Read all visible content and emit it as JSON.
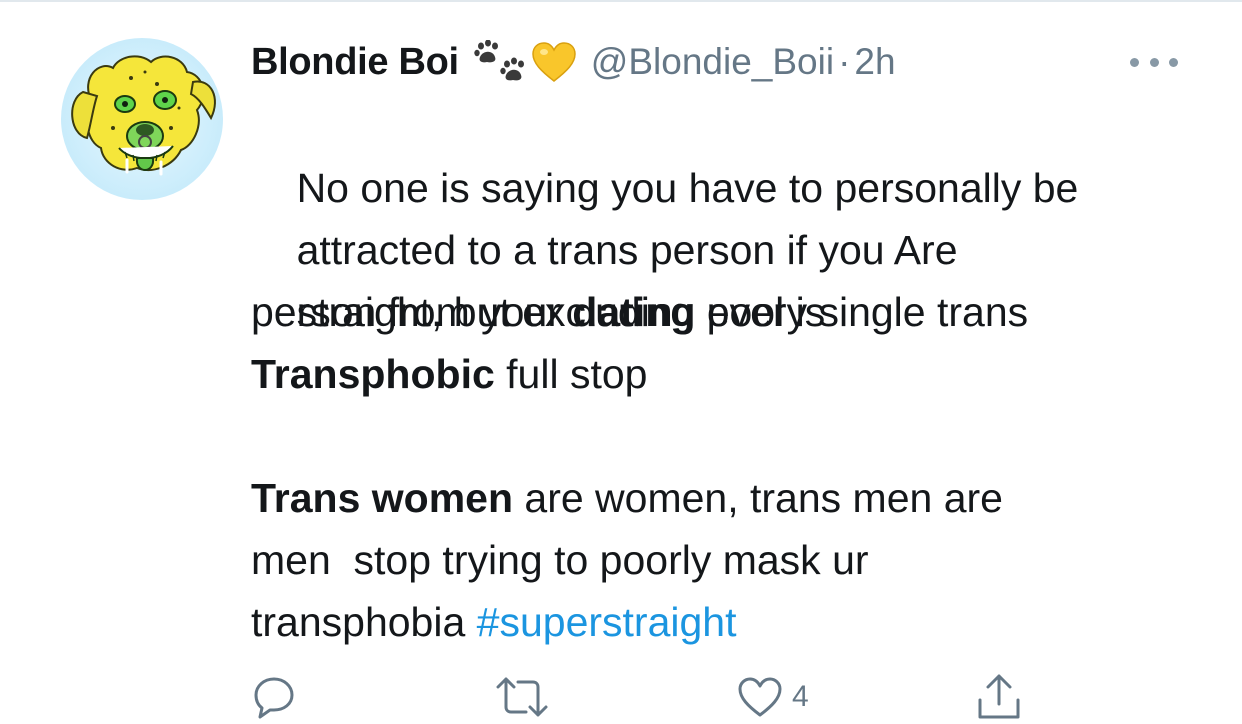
{
  "tweet": {
    "author": {
      "display_name": "Blondie Boi",
      "emoji": [
        "paw-prints",
        "yellow-heart"
      ],
      "handle": "@Blondie_Boii",
      "separator": "·",
      "time": "2h"
    },
    "body_lines": [
      [
        {
          "text": "No one is saying you have to personally be",
          "bold": false
        }
      ],
      [
        {
          "text": "attracted to a trans person if you Are",
          "bold": false
        }
      ],
      [
        {
          "text": "straight, but excluding every single trans",
          "bold": false
        }
      ],
      [
        {
          "text": "person from your ",
          "bold": false
        },
        {
          "text": "dating",
          "bold": true
        },
        {
          "text": " pool is",
          "bold": false
        }
      ],
      [
        {
          "text": "Transphobic",
          "bold": true
        },
        {
          "text": " full stop",
          "bold": false
        }
      ],
      [],
      [
        {
          "text": "Trans women",
          "bold": true
        },
        {
          "text": " are women, trans men are",
          "bold": false
        }
      ],
      [
        {
          "text": "men  stop trying to poorly mask ur",
          "bold": false
        }
      ],
      [
        {
          "text": "transphobia ",
          "bold": false
        },
        {
          "text": "#superstraight",
          "hashtag": true
        }
      ]
    ],
    "actions": {
      "reply_icon": "reply-icon",
      "retweet_icon": "retweet-icon",
      "like_icon": "heart-icon",
      "like_count": "4",
      "share_icon": "share-icon"
    }
  },
  "colors": {
    "text": "#14171a",
    "secondary": "#657786",
    "link": "#1b95e0",
    "icon": "#657786",
    "divider": "#e1e8ed"
  }
}
